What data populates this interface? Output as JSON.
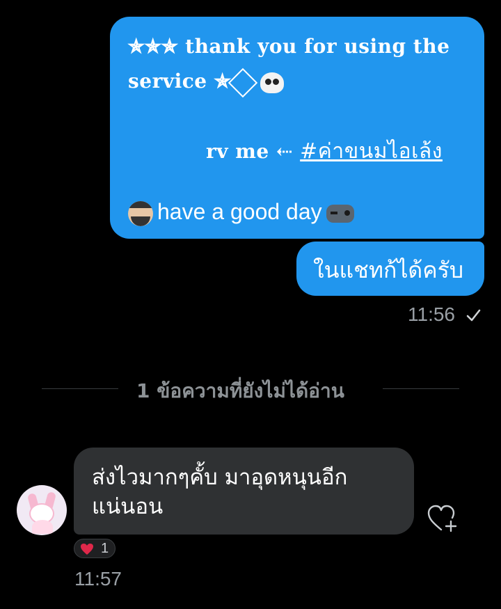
{
  "conversation": {
    "outgoing": [
      {
        "line1": "✯✯✯ thank you for using the",
        "line2_text": "service ✯",
        "line3_prefix": "rv me ⇠ ",
        "line3_link": "#ค่าขนมไอเล้ง",
        "line4_text": "have a good day",
        "emoji": [
          "skull-emoji",
          "bearded-man-emoji",
          "game-controller-emoji"
        ]
      },
      {
        "text": "ในแชทก้ได้ครับ"
      }
    ],
    "outgoing_time": "11:56",
    "read_status": "check-icon",
    "unread_divider": "1 ข้อความที่ยังไม่ได้อ่าน",
    "incoming": {
      "line1": "ส่งไวมากๆคั้บ มาอุดหนุนอีก",
      "line2": "แน่นอน",
      "reaction_emoji": "heart",
      "reaction_count": "1",
      "time": "11:57"
    }
  },
  "colors": {
    "background": "#000000",
    "outgoing_bubble": "#2196ee",
    "incoming_bubble": "#2f3133",
    "muted_text": "#9aa0a6",
    "heart": "#e0284a"
  }
}
